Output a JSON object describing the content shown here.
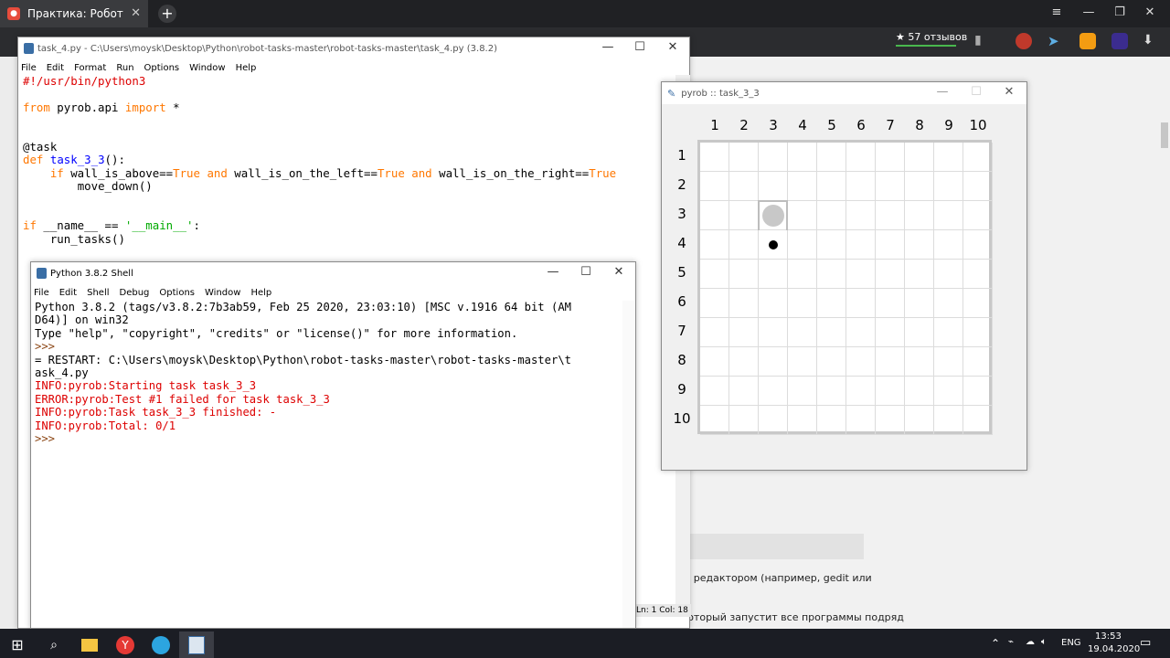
{
  "browser": {
    "tab_title": "Практика: Робот",
    "rating": "★ 57 отзывов",
    "page_text_1": "м редактором (например, gedit или",
    "page_text_2": "asks.py, который запустит все программы подряд"
  },
  "editor": {
    "title": "task_4.py - C:\\Users\\moysk\\Desktop\\Python\\robot-tasks-master\\robot-tasks-master\\task_4.py (3.8.2)",
    "menu": [
      "File",
      "Edit",
      "Format",
      "Run",
      "Options",
      "Window",
      "Help"
    ],
    "status": "Ln: 1   Col: 18",
    "code": {
      "shebang": "#!/usr/bin/python3",
      "import_from": "from",
      "import_module": " pyrob.api ",
      "import_kw": "import",
      "import_rest": " *",
      "decorator": "@task",
      "def_kw": "def",
      "func_name": "task_3_3",
      "def_rest": "():",
      "if_kw": "if",
      "cond1": " wall_is_above==",
      "true_kw": "True",
      "and_kw": "and",
      "cond2": " wall_is_on_the_left==",
      "cond3": " wall_is_on_the_right==",
      "move": "move_down()",
      "main_if": "if",
      "main_name": " __name__ == ",
      "main_str": "'__main__'",
      "main_colon": ":",
      "run": "run_tasks()"
    }
  },
  "shell": {
    "title": "Python 3.8.2 Shell",
    "menu": [
      "File",
      "Edit",
      "Shell",
      "Debug",
      "Options",
      "Window",
      "Help"
    ],
    "lines": {
      "l1": "Python 3.8.2 (tags/v3.8.2:7b3ab59, Feb 25 2020, 23:03:10) [MSC v.1916 64 bit (AM",
      "l2": "D64)] on win32",
      "l3": "Type \"help\", \"copyright\", \"credits\" or \"license()\" for more information.",
      "l4": ">>>",
      "l5": "= RESTART: C:\\Users\\moysk\\Desktop\\Python\\robot-tasks-master\\robot-tasks-master\\t",
      "l6": "ask_4.py",
      "l7": "INFO:pyrob:Starting task task_3_3",
      "l8": "ERROR:pyrob:Test #1 failed for task task_3_3",
      "l9": "INFO:pyrob:Task task_3_3 finished: -",
      "l10": "INFO:pyrob:Total: 0/1",
      "l11": ">>>"
    }
  },
  "robot_window": {
    "title": "pyrob :: task_3_3",
    "columns": [
      "1",
      "2",
      "3",
      "4",
      "5",
      "6",
      "7",
      "8",
      "9",
      "10"
    ],
    "rows": [
      "1",
      "2",
      "3",
      "4",
      "5",
      "6",
      "7",
      "8",
      "9",
      "10"
    ],
    "robot_cell": {
      "row": 3,
      "col": 3
    },
    "target_cell": {
      "row": 4,
      "col": 3
    },
    "walls_cell": {
      "row": 3,
      "col": 3,
      "sides": [
        "top",
        "left",
        "right"
      ]
    }
  },
  "taskbar": {
    "time": "13:53",
    "date": "19.04.2020",
    "lang": "ENG"
  },
  "colors": {
    "keyword": "#ff7700",
    "function": "#0000ff",
    "string": "#00aa00",
    "error": "#dd0000"
  }
}
